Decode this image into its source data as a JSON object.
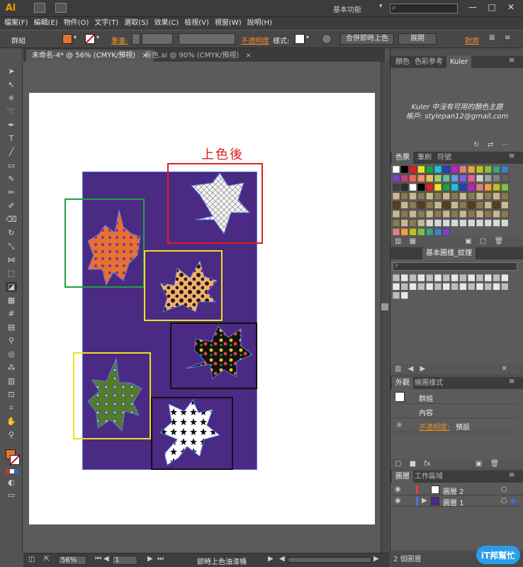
{
  "app": {
    "logo": "Ai",
    "workspace": "基本功能",
    "search_placeholder": ""
  },
  "menu": [
    "檔案(F)",
    "編輯(E)",
    "物件(O)",
    "文字(T)",
    "選取(S)",
    "效果(C)",
    "檢視(V)",
    "視窗(W)",
    "說明(H)"
  ],
  "control": {
    "selection": "群組",
    "stroke_label": "筆畫:",
    "opacity_label": "不透明度",
    "style_label": "樣式:",
    "merge_button": "合併即時上色",
    "expand_button": "展開",
    "align_label": "對齊"
  },
  "tabs": [
    {
      "label": "未命名-4* @ 56% (CMYK/預視)",
      "close": "×"
    },
    {
      "label": "着色.ai @ 90% (CMYK/預視)",
      "close": "×"
    }
  ],
  "annotation": "上色後",
  "status": {
    "zoom": "56%",
    "page": "1",
    "tool": "即時上色油漆桶"
  },
  "panels": {
    "color_tabs": [
      "顏色",
      "色彩參考",
      "Kuler"
    ],
    "kuler_line1": "Kuler 中沒有可用的顏色主題",
    "kuler_line2": "帳戶: stylepan12@gmail.com",
    "swatch_tabs": [
      "色票",
      "筆刷",
      "符號"
    ],
    "library_tab": "基本圖樣_紋理",
    "appearance_tabs": [
      "外觀",
      "繪圖樣式"
    ],
    "appearance_rows": [
      {
        "label": "群組"
      },
      {
        "label": "內容"
      },
      {
        "label": "不透明度:",
        "value": "預設"
      }
    ],
    "layers_tabs": [
      "圖層",
      "工作區域"
    ],
    "layers": [
      {
        "name": "圖層 2",
        "color": "#e34040"
      },
      {
        "name": "圖層 1",
        "color": "#4f6fe6"
      }
    ],
    "layers_footer": "2 個圖層"
  },
  "watermark": "iT邦幫忙",
  "colors": {
    "accent": "#f08c28",
    "purple_bg": "#4a2a82",
    "red_box": "#e02020",
    "green_box": "#22a040",
    "yellow_box": "#f0e020",
    "black_box": "#111111"
  }
}
